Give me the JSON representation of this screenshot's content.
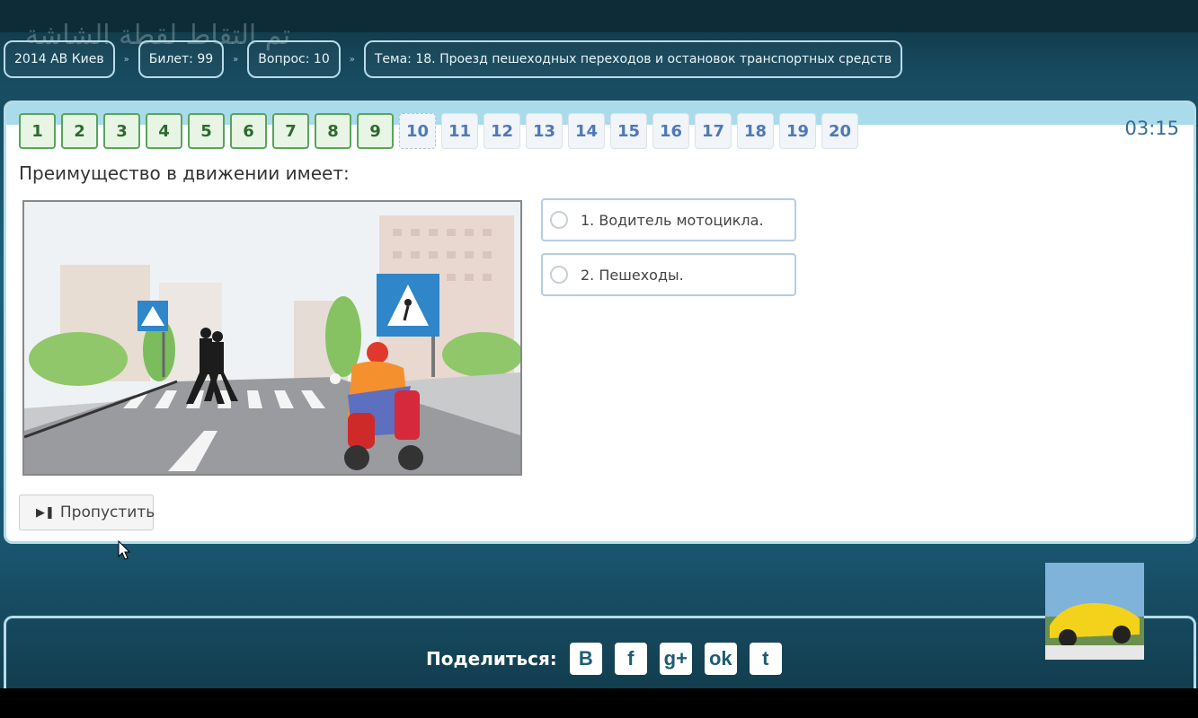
{
  "watermark": "تم التقاط لقطة الشاشة",
  "breadcrumb": {
    "items": [
      "2014 АВ Киев",
      "Билет: 99",
      "Вопрос: 10",
      "Тема: 18. Проезд пешеходных переходов и остановок транспортных средств"
    ],
    "separator": "»"
  },
  "question_nav": [
    {
      "label": "1",
      "state": "done"
    },
    {
      "label": "2",
      "state": "done"
    },
    {
      "label": "3",
      "state": "done"
    },
    {
      "label": "4",
      "state": "done"
    },
    {
      "label": "5",
      "state": "done"
    },
    {
      "label": "6",
      "state": "done"
    },
    {
      "label": "7",
      "state": "done"
    },
    {
      "label": "8",
      "state": "done"
    },
    {
      "label": "9",
      "state": "done"
    },
    {
      "label": "10",
      "state": "current"
    },
    {
      "label": "11",
      "state": "todo"
    },
    {
      "label": "12",
      "state": "todo"
    },
    {
      "label": "13",
      "state": "todo"
    },
    {
      "label": "14",
      "state": "todo"
    },
    {
      "label": "15",
      "state": "todo"
    },
    {
      "label": "16",
      "state": "todo"
    },
    {
      "label": "17",
      "state": "todo"
    },
    {
      "label": "18",
      "state": "todo"
    },
    {
      "label": "19",
      "state": "todo"
    },
    {
      "label": "20",
      "state": "todo"
    }
  ],
  "timer": "03:15",
  "question": {
    "text": "Преимущество в движении имеет:",
    "answers": [
      "1. Водитель мотоцикла.",
      "2. Пешеходы."
    ]
  },
  "skip_button": {
    "label": "Пропустить",
    "icon": "skip-forward-icon"
  },
  "share": {
    "label": "Поделиться:",
    "icons": [
      {
        "name": "vk-icon",
        "glyph": "B"
      },
      {
        "name": "facebook-icon",
        "glyph": "f"
      },
      {
        "name": "google-plus-icon",
        "glyph": "g+"
      },
      {
        "name": "odnoklassniki-icon",
        "glyph": "ok"
      },
      {
        "name": "twitter-icon",
        "glyph": "t"
      }
    ]
  },
  "colors": {
    "done": "#57a55a",
    "accent": "#4f79b6",
    "frame": "#b5dcea"
  }
}
